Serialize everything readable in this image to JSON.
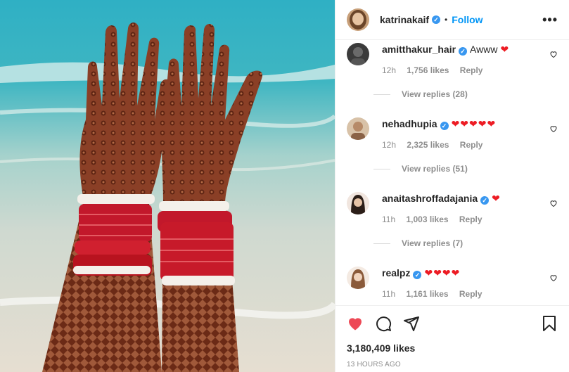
{
  "post": {
    "author": "katrinakaif",
    "follow_label": "Follow",
    "dot": "•",
    "more_label": "•••",
    "verified_mark": "✓"
  },
  "comments": [
    {
      "username": "amitthakur_hair",
      "text": "Awww",
      "hearts": "❤",
      "time": "12h",
      "likes": "1,756 likes",
      "reply": "Reply",
      "view_replies": "View replies (28)"
    },
    {
      "username": "nehadhupia",
      "text": "",
      "hearts": "❤❤❤❤❤",
      "time": "12h",
      "likes": "2,325 likes",
      "reply": "Reply",
      "view_replies": "View replies (51)"
    },
    {
      "username": "anaitashroffadajania",
      "text": "",
      "hearts": "❤",
      "time": "11h",
      "likes": "1,003 likes",
      "reply": "Reply",
      "view_replies": "View replies (7)"
    },
    {
      "username": "realpz",
      "text": "",
      "hearts": "❤❤❤❤",
      "time": "11h",
      "likes": "1,161 likes",
      "reply": "Reply",
      "view_replies": ""
    }
  ],
  "footer": {
    "likes": "3,180,409 likes",
    "timestamp": "13 HOURS AGO"
  },
  "icons": [
    "heart-icon",
    "comment-icon",
    "share-icon",
    "bookmark-icon",
    "more-icon",
    "verified-icon"
  ],
  "colors": {
    "accent": "#0095f6",
    "like_red": "#ed4956",
    "verified": "#3897f0"
  }
}
